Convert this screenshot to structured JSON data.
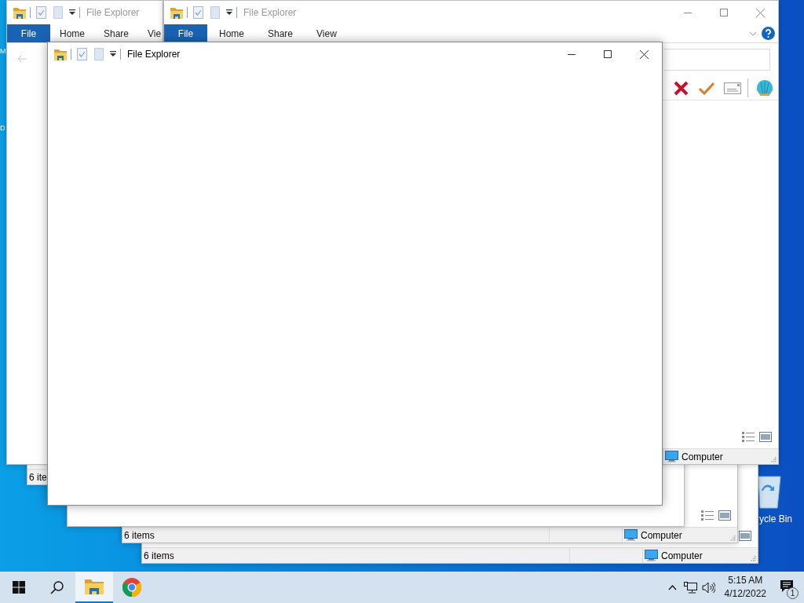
{
  "desktop": {
    "edge_labels": [
      "M",
      "D"
    ],
    "recycle_bin_label": "ycle Bin"
  },
  "windows": [
    {
      "kind": "ribbon_partial",
      "title": "File Explorer",
      "active": false,
      "tabs": [
        {
          "label": "File",
          "selected": true
        },
        {
          "label": "Home",
          "selected": false
        },
        {
          "label": "Share",
          "selected": false
        },
        {
          "label": "Vie",
          "selected": false
        }
      ]
    },
    {
      "kind": "ribbon_full",
      "title": "File Explorer",
      "active": false,
      "tabs": [
        {
          "label": "File",
          "selected": true
        },
        {
          "label": "Home",
          "selected": false
        },
        {
          "label": "Share",
          "selected": false
        },
        {
          "label": "View",
          "selected": false
        }
      ],
      "location": "Computer"
    },
    {
      "kind": "titlebar",
      "title": "File Explorer",
      "active": true
    },
    {
      "kind": "statusbar_partial",
      "items": "6 ite"
    },
    {
      "kind": "blank"
    },
    {
      "kind": "statusbar_views",
      "items": "6 items",
      "location": "Computer"
    },
    {
      "kind": "statusbar",
      "items": "6 items",
      "location": "Computer"
    }
  ],
  "taskbar": {
    "apps": [
      {
        "kind": "explorer",
        "selected": true
      },
      {
        "kind": "chrome",
        "selected": false
      }
    ],
    "time": "5:15 AM",
    "date": "4/12/2022",
    "notifications": "1"
  }
}
